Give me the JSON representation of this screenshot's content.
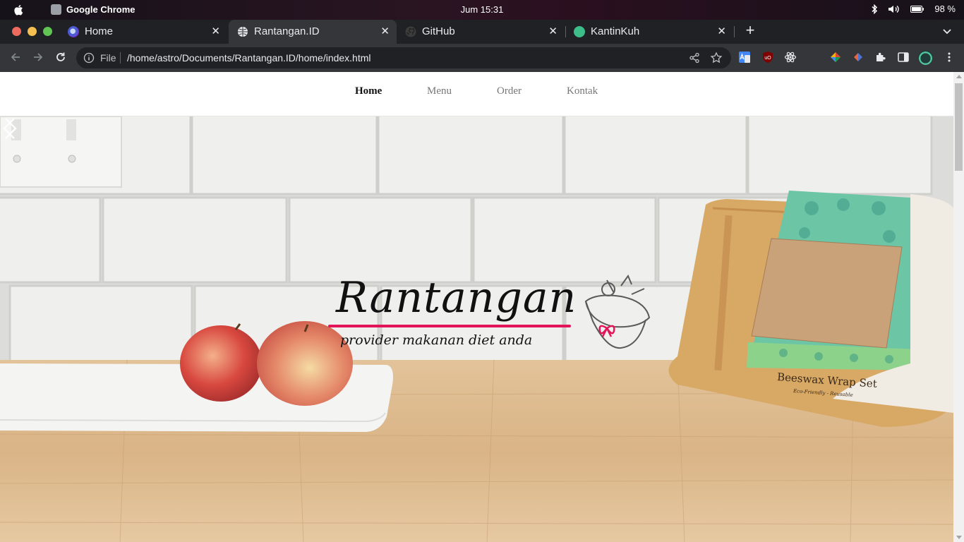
{
  "system_bar": {
    "app_name": "Google Chrome",
    "clock": "Jum 15:31",
    "battery": "98 %"
  },
  "tabs": [
    {
      "title": "Home",
      "active": false
    },
    {
      "title": "Rantangan.ID",
      "active": true
    },
    {
      "title": "GitHub",
      "active": false
    },
    {
      "title": "KantinKuh",
      "active": false
    }
  ],
  "omnibox": {
    "scheme_label": "File",
    "url": "/home/astro/Documents/Rantangan.ID/home/index.html"
  },
  "site_nav": {
    "items": [
      "Home",
      "Menu",
      "Order",
      "Kontak"
    ],
    "active": "Home"
  },
  "hero": {
    "logo_text": "Rantangan",
    "tagline": "provider makanan diet anda",
    "product_label_title": "Beeswax Wrap Set",
    "product_label_sub": "Eco-Friendly - Reusable"
  },
  "colors": {
    "accent": "#e4145b",
    "chrome_dark": "#202124",
    "chrome_toolbar": "#35363a"
  }
}
